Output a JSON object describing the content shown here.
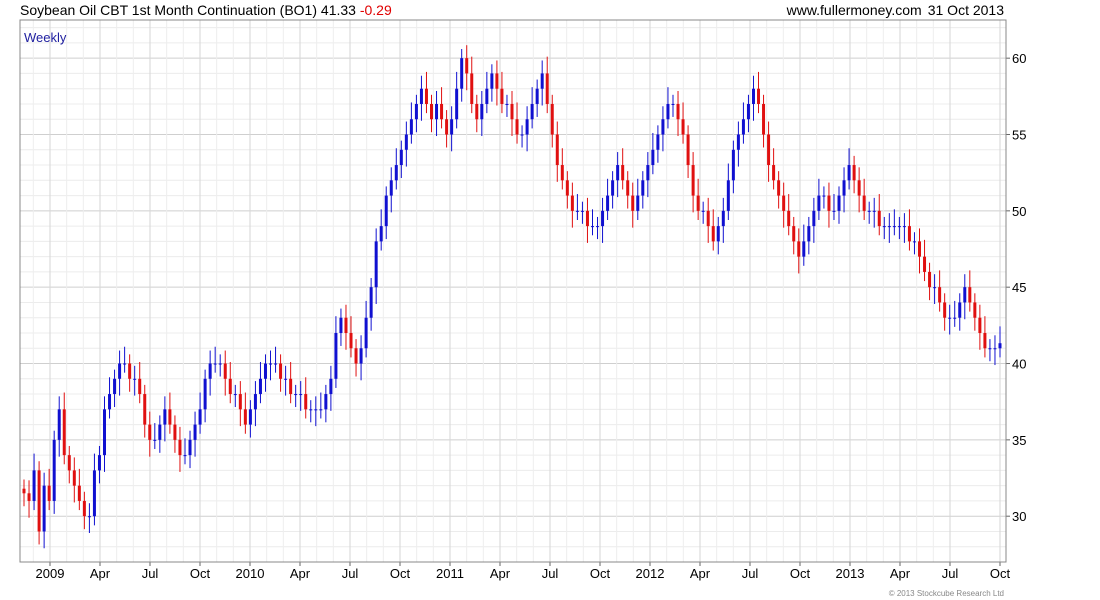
{
  "header": {
    "title": "Soybean Oil CBT 1st Month Continuation (BO1)",
    "last": "41.33",
    "change": "-0.29",
    "site": "www.fullermoney.com",
    "date": "31 Oct 2013"
  },
  "copyright": "© 2013 Stockcube Research Ltd",
  "colors": {
    "up": "#1010d0",
    "down": "#e01010",
    "grid": "#d8d8d8",
    "frame": "#888888"
  },
  "chart_data": {
    "type": "candlestick",
    "period_label": "Weekly",
    "ylim": [
      27,
      62.5
    ],
    "y_ticks": [
      30,
      35,
      40,
      45,
      50,
      55,
      60
    ],
    "x_ticks": [
      "2009",
      "Apr",
      "Jul",
      "Oct",
      "2010",
      "Apr",
      "Jul",
      "Oct",
      "2011",
      "Apr",
      "Jul",
      "Oct",
      "2012",
      "Apr",
      "Jul",
      "Oct",
      "2013",
      "Apr",
      "Jul",
      "Oct"
    ],
    "grid": true,
    "last_close": 41.33,
    "change": -0.29,
    "series": [
      {
        "values": [
          31.5,
          31,
          33,
          29,
          32,
          31,
          35,
          37,
          34,
          33,
          32,
          31,
          30,
          30,
          33,
          34,
          37,
          38,
          39,
          40,
          40,
          39,
          39,
          38,
          36,
          35,
          35,
          36,
          37,
          36,
          35,
          34,
          34,
          35,
          36,
          37,
          39,
          40,
          40,
          40,
          39,
          38,
          38,
          37,
          36,
          37,
          38,
          39,
          40,
          40,
          40,
          39,
          39,
          38,
          38,
          38,
          37,
          37,
          37,
          37,
          38,
          39,
          42,
          43,
          42,
          41,
          40,
          41,
          43,
          45,
          48,
          49,
          51,
          52,
          53,
          54,
          55,
          56,
          57,
          58,
          57,
          56,
          57,
          56,
          55,
          56,
          58,
          60,
          59,
          57,
          56,
          57,
          58,
          59,
          58,
          57,
          57,
          56,
          55,
          55,
          56,
          57,
          58,
          59,
          57,
          55,
          53,
          52,
          51,
          50,
          50,
          50,
          49,
          49,
          49,
          50,
          51,
          52,
          53,
          52,
          51,
          50,
          51,
          52,
          53,
          54,
          55,
          56,
          57,
          57,
          56,
          55,
          53,
          51,
          50,
          50,
          49,
          48,
          49,
          50,
          52,
          54,
          55,
          56,
          57,
          58,
          57,
          55,
          53,
          52,
          51,
          50,
          49,
          48,
          47,
          48,
          49,
          50,
          51,
          51,
          50,
          50,
          51,
          52,
          53,
          52,
          51,
          50,
          50,
          50,
          49,
          49,
          49,
          49,
          49,
          49,
          48,
          48,
          47,
          46,
          45,
          45,
          44,
          43,
          43,
          43,
          44,
          45,
          44,
          43,
          42,
          41,
          41,
          41,
          41.33
        ]
      }
    ]
  }
}
